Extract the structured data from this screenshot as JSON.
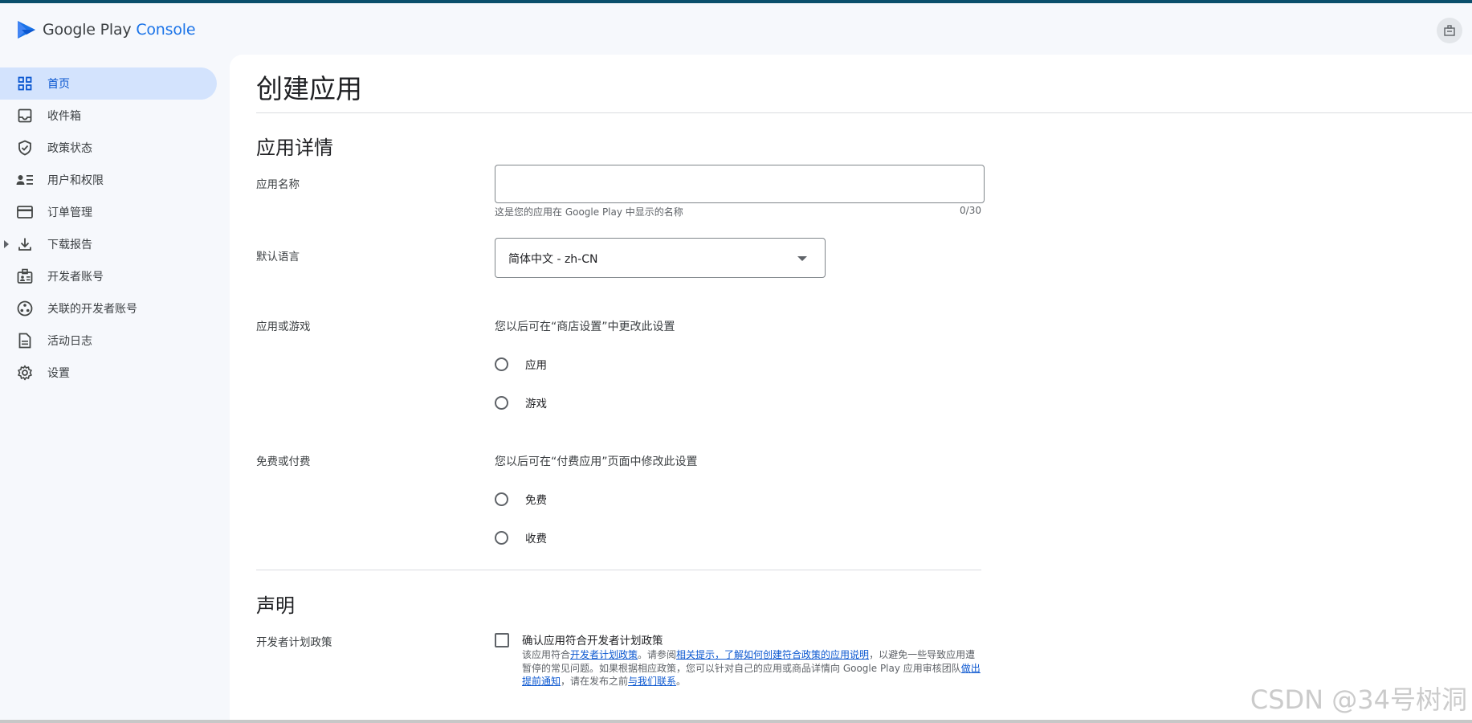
{
  "app": {
    "logo_text_main": "Google Play",
    "logo_text_accent": "Console",
    "brand_color": "#1a73e8",
    "accent_bar_color": "#0b4f6c"
  },
  "header": {
    "right_icon": "admin-panel-icon"
  },
  "sidebar": {
    "items": [
      {
        "label": "首页",
        "icon": "dashboard-grid-icon",
        "active": true
      },
      {
        "label": "收件箱",
        "icon": "inbox-icon"
      },
      {
        "label": "政策状态",
        "icon": "shield-check-icon"
      },
      {
        "label": "用户和权限",
        "icon": "people-list-icon"
      },
      {
        "label": "订单管理",
        "icon": "credit-card-icon"
      },
      {
        "label": "下载报告",
        "icon": "download-icon",
        "expandable": true
      },
      {
        "label": "开发者账号",
        "icon": "badge-icon"
      },
      {
        "label": "关联的开发者账号",
        "icon": "linked-accounts-icon"
      },
      {
        "label": "活动日志",
        "icon": "document-icon"
      },
      {
        "label": "设置",
        "icon": "gear-icon"
      }
    ]
  },
  "main": {
    "page_title": "创建应用",
    "app_details": {
      "section_title": "应用详情",
      "name_label": "应用名称",
      "name_value": "",
      "name_hint": "这是您的应用在 Google Play 中显示的名称",
      "name_counter": "0/30",
      "language_label": "默认语言",
      "language_value": "简体中文 - zh-CN",
      "type_label": "应用或游戏",
      "type_desc": "您以后可在“商店设置”中更改此设置",
      "type_options": [
        "应用",
        "游戏"
      ],
      "price_label": "免费或付费",
      "price_desc": "您以后可在“付费应用”页面中修改此设置",
      "price_options": [
        "免费",
        "收费"
      ]
    },
    "declarations": {
      "section_title": "声明",
      "policy_label": "开发者计划政策",
      "checkbox_label": "确认应用符合开发者计划政策",
      "desc_parts": {
        "p1": "该应用符合",
        "link1": "开发者计划政策",
        "p2": "。请参阅",
        "link2": "相关提示，了解如何创建符合政策的应用说明",
        "p3": "，以避免一些导致应用遭暂停的常见问题。如果根据相应政策，您可以针对自己的应用或商品详情向 Google Play 应用审核团队",
        "link3": "做出提前通知",
        "p4": "，请在发布之前",
        "link4": "与我们联系",
        "p5": "。"
      }
    }
  },
  "watermark": "CSDN @34号树洞"
}
